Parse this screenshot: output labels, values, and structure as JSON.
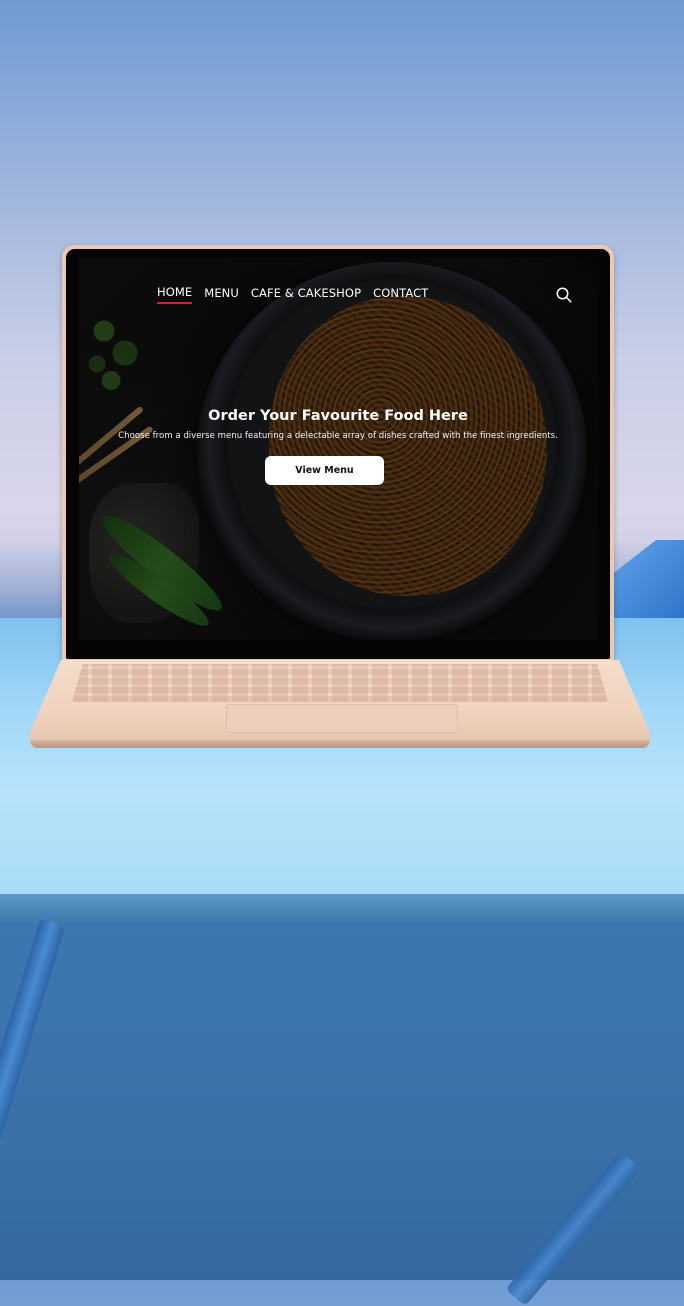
{
  "nav": {
    "items": [
      {
        "label": "HOME",
        "active": true
      },
      {
        "label": "MENU",
        "active": false
      },
      {
        "label": "CAFE & CAKESHOP",
        "active": false
      },
      {
        "label": "CONTACT",
        "active": false
      }
    ],
    "search_icon": "search-icon",
    "active_accent": "#d2233a"
  },
  "hero": {
    "title": "Order Your Favourite Food Here",
    "subtitle": "Choose from a diverse menu featuring a delectable array of dishes crafted with the finest ingredients.",
    "button_label": "View Menu"
  }
}
